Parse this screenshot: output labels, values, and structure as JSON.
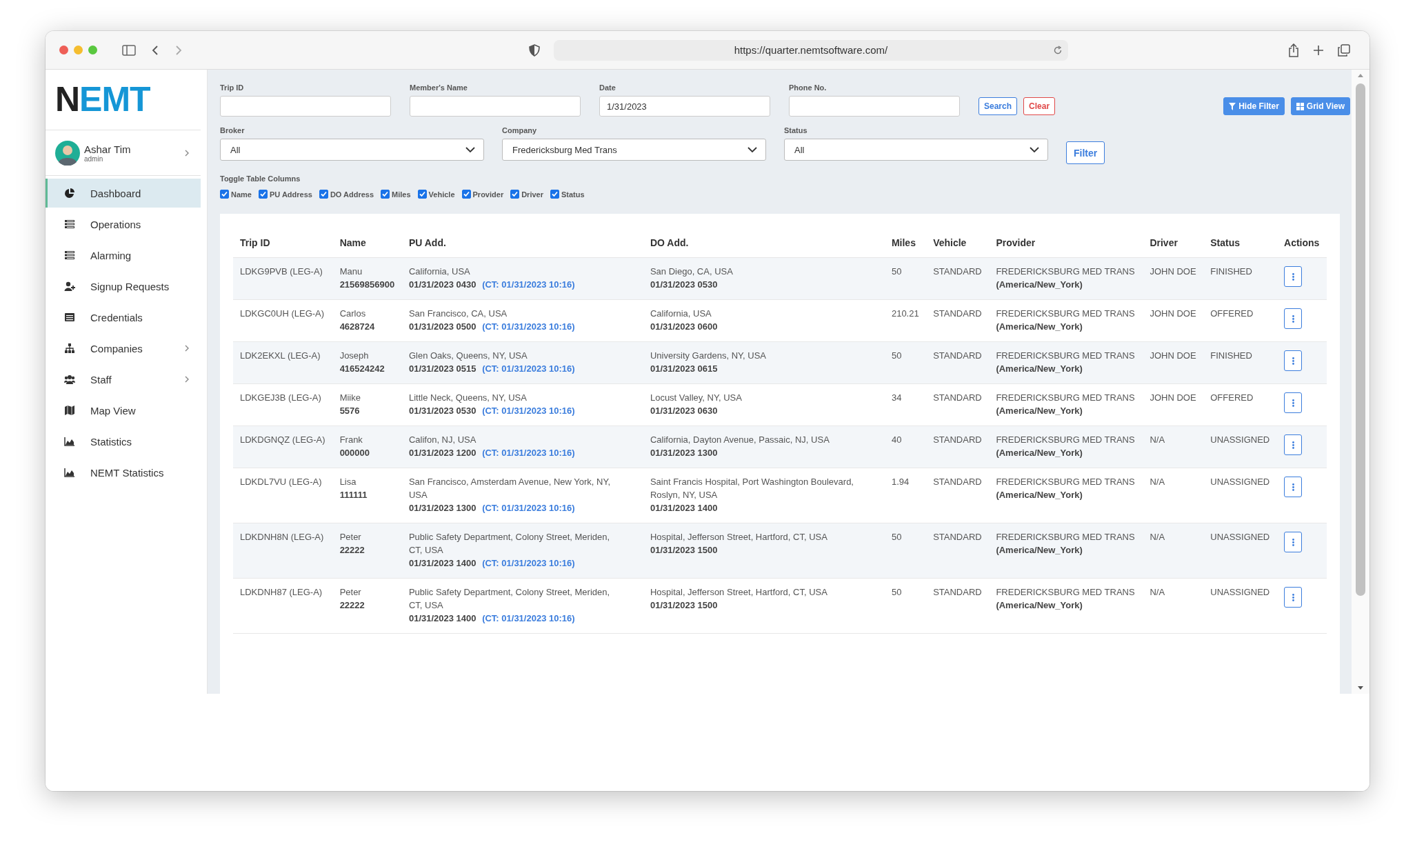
{
  "browser": {
    "url": "https://quarter.nemtsoftware.com/"
  },
  "sidebar": {
    "logo": {
      "dark": "N",
      "blue": "EMT"
    },
    "user": {
      "name": "Ashar Tim",
      "role": "admin"
    },
    "items": [
      {
        "label": "Dashboard",
        "selected": true,
        "has_submenu": false
      },
      {
        "label": "Operations",
        "selected": false,
        "has_submenu": false
      },
      {
        "label": "Alarming",
        "selected": false,
        "has_submenu": false
      },
      {
        "label": "Signup Requests",
        "selected": false,
        "has_submenu": false
      },
      {
        "label": "Credentials",
        "selected": false,
        "has_submenu": false
      },
      {
        "label": "Companies",
        "selected": false,
        "has_submenu": true
      },
      {
        "label": "Staff",
        "selected": false,
        "has_submenu": true
      },
      {
        "label": "Map View",
        "selected": false,
        "has_submenu": false
      },
      {
        "label": "Statistics",
        "selected": false,
        "has_submenu": false
      },
      {
        "label": "NEMT Statistics",
        "selected": false,
        "has_submenu": false
      }
    ]
  },
  "filters": {
    "fields": [
      {
        "label": "Trip ID"
      },
      {
        "label": "Member's Name"
      },
      {
        "label": "Date",
        "value": "1/31/2023"
      },
      {
        "label": "Phone No."
      }
    ],
    "search_button": "Search",
    "clear_button": "Clear",
    "hide_filter_button": "Hide Filter",
    "grid_view_button": "Grid View",
    "selects": [
      {
        "label": "Broker",
        "value": "All"
      },
      {
        "label": "Company",
        "value": "Fredericksburg Med Trans"
      },
      {
        "label": "Status",
        "value": "All"
      }
    ],
    "filter_button": "Filter",
    "toggle_title": "Toggle Table Columns",
    "toggles": [
      {
        "label": "Name",
        "checked": true
      },
      {
        "label": "PU Address",
        "checked": true
      },
      {
        "label": "DO Address",
        "checked": true
      },
      {
        "label": "Miles",
        "checked": true
      },
      {
        "label": "Vehicle",
        "checked": true
      },
      {
        "label": "Provider",
        "checked": true
      },
      {
        "label": "Driver",
        "checked": true
      },
      {
        "label": "Status",
        "checked": true
      }
    ]
  },
  "table": {
    "columns": [
      "Trip ID",
      "Name",
      "PU Add.",
      "DO Add.",
      "Miles",
      "Vehicle",
      "Provider",
      "Driver",
      "Status",
      "Actions"
    ],
    "rows": [
      {
        "trip_id": "LDKG9PVB (LEG-A)",
        "name": "Manu",
        "member_id": "21569856900",
        "pu_address": "California, USA",
        "pu_time": "01/31/2023 0430",
        "pu_ct": "(CT: 01/31/2023 10:16)",
        "do_address": "San Diego, CA, USA",
        "do_time": "01/31/2023 0530",
        "miles": "50",
        "vehicle": "STANDARD",
        "provider": "FREDERICKSBURG MED TRANS",
        "provider_tz": "(America/New_York)",
        "driver": "JOHN DOE",
        "status": "FINISHED"
      },
      {
        "trip_id": "LDKGC0UH (LEG-A)",
        "name": "Carlos",
        "member_id": "4628724",
        "pu_address": "San Francisco, CA, USA",
        "pu_time": "01/31/2023 0500",
        "pu_ct": "(CT: 01/31/2023 10:16)",
        "do_address": "California, USA",
        "do_time": "01/31/2023 0600",
        "miles": "210.21",
        "vehicle": "STANDARD",
        "provider": "FREDERICKSBURG MED TRANS",
        "provider_tz": "(America/New_York)",
        "driver": "JOHN DOE",
        "status": "OFFERED"
      },
      {
        "trip_id": "LDK2EKXL (LEG-A)",
        "name": "Joseph",
        "member_id": "416524242",
        "pu_address": "Glen Oaks, Queens, NY, USA",
        "pu_time": "01/31/2023 0515",
        "pu_ct": "(CT: 01/31/2023 10:16)",
        "do_address": "University Gardens, NY, USA",
        "do_time": "01/31/2023 0615",
        "miles": "50",
        "vehicle": "STANDARD",
        "provider": "FREDERICKSBURG MED TRANS",
        "provider_tz": "(America/New_York)",
        "driver": "JOHN DOE",
        "status": "FINISHED"
      },
      {
        "trip_id": "LDKGEJ3B (LEG-A)",
        "name": "Miike",
        "member_id": "5576",
        "pu_address": "Little Neck, Queens, NY, USA",
        "pu_time": "01/31/2023 0530",
        "pu_ct": "(CT: 01/31/2023 10:16)",
        "do_address": "Locust Valley, NY, USA",
        "do_time": "01/31/2023 0630",
        "miles": "34",
        "vehicle": "STANDARD",
        "provider": "FREDERICKSBURG MED TRANS",
        "provider_tz": "(America/New_York)",
        "driver": "JOHN DOE",
        "status": "OFFERED"
      },
      {
        "trip_id": "LDKDGNQZ (LEG-A)",
        "name": "Frank",
        "member_id": "000000",
        "pu_address": "Califon, NJ, USA",
        "pu_time": "01/31/2023 1200",
        "pu_ct": "(CT: 01/31/2023 10:16)",
        "do_address": "California, Dayton Avenue, Passaic, NJ, USA",
        "do_time": "01/31/2023 1300",
        "miles": "40",
        "vehicle": "STANDARD",
        "provider": "FREDERICKSBURG MED TRANS",
        "provider_tz": "(America/New_York)",
        "driver": "N/A",
        "status": "UNASSIGNED"
      },
      {
        "trip_id": "LDKDL7VU (LEG-A)",
        "name": "Lisa",
        "member_id": "111111",
        "pu_address": "San Francisco, Amsterdam Avenue, New York, NY, USA",
        "pu_time": "01/31/2023 1300",
        "pu_ct": "(CT: 01/31/2023 10:16)",
        "do_address": "Saint Francis Hospital, Port Washington Boulevard, Roslyn, NY, USA",
        "do_time": "01/31/2023 1400",
        "miles": "1.94",
        "vehicle": "STANDARD",
        "provider": "FREDERICKSBURG MED TRANS",
        "provider_tz": "(America/New_York)",
        "driver": "N/A",
        "status": "UNASSIGNED"
      },
      {
        "trip_id": "LDKDNH8N (LEG-A)",
        "name": "Peter",
        "member_id": "22222",
        "pu_address": "Public Safety Department, Colony Street, Meriden, CT, USA",
        "pu_time": "01/31/2023 1400",
        "pu_ct": "(CT: 01/31/2023 10:16)",
        "do_address": "Hospital, Jefferson Street, Hartford, CT, USA",
        "do_time": "01/31/2023 1500",
        "miles": "50",
        "vehicle": "STANDARD",
        "provider": "FREDERICKSBURG MED TRANS",
        "provider_tz": "(America/New_York)",
        "driver": "N/A",
        "status": "UNASSIGNED"
      },
      {
        "trip_id": "LDKDNH87 (LEG-A)",
        "name": "Peter",
        "member_id": "22222",
        "pu_address": "Public Safety Department, Colony Street, Meriden, CT, USA",
        "pu_time": "01/31/2023 1400",
        "pu_ct": "(CT: 01/31/2023 10:16)",
        "do_address": "Hospital, Jefferson Street, Hartford, CT, USA",
        "do_time": "01/31/2023 1500",
        "miles": "50",
        "vehicle": "STANDARD",
        "provider": "FREDERICKSBURG MED TRANS",
        "provider_tz": "(America/New_York)",
        "driver": "N/A",
        "status": "UNASSIGNED"
      }
    ]
  }
}
